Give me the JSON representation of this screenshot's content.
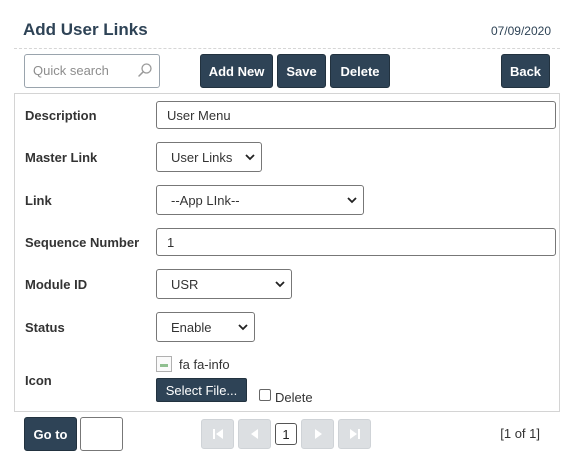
{
  "header": {
    "title": "Add User Links",
    "date": "07/09/2020"
  },
  "toolbar": {
    "search_placeholder": "Quick search",
    "add_new_label": "Add New",
    "save_label": "Save",
    "delete_label": "Delete",
    "back_label": "Back"
  },
  "form": {
    "description": {
      "label": "Description",
      "value": "User Menu"
    },
    "master_link": {
      "label": "Master Link",
      "value": "User Links"
    },
    "link": {
      "label": "Link",
      "value": "--App LInk--"
    },
    "sequence_number": {
      "label": "Sequence Number",
      "value": "1"
    },
    "module_id": {
      "label": "Module ID",
      "value": "USR"
    },
    "status": {
      "label": "Status",
      "value": "Enable"
    },
    "icon": {
      "label": "Icon",
      "image_alt": "fa fa-info",
      "select_file_label": "Select File...",
      "delete_label": "Delete",
      "delete_checked": false
    }
  },
  "pager": {
    "goto_label": "Go to",
    "goto_value": "",
    "current_page": "1",
    "page_count_text": "[1 of 1]"
  },
  "colors": {
    "primary": "#2e4356",
    "disabled_pager": "#dcdfe2",
    "border": "#d4d4d4"
  },
  "icons": [
    "search-icon",
    "chevron-down-icon",
    "first-page-icon",
    "previous-page-icon",
    "next-page-icon",
    "last-page-icon"
  ]
}
